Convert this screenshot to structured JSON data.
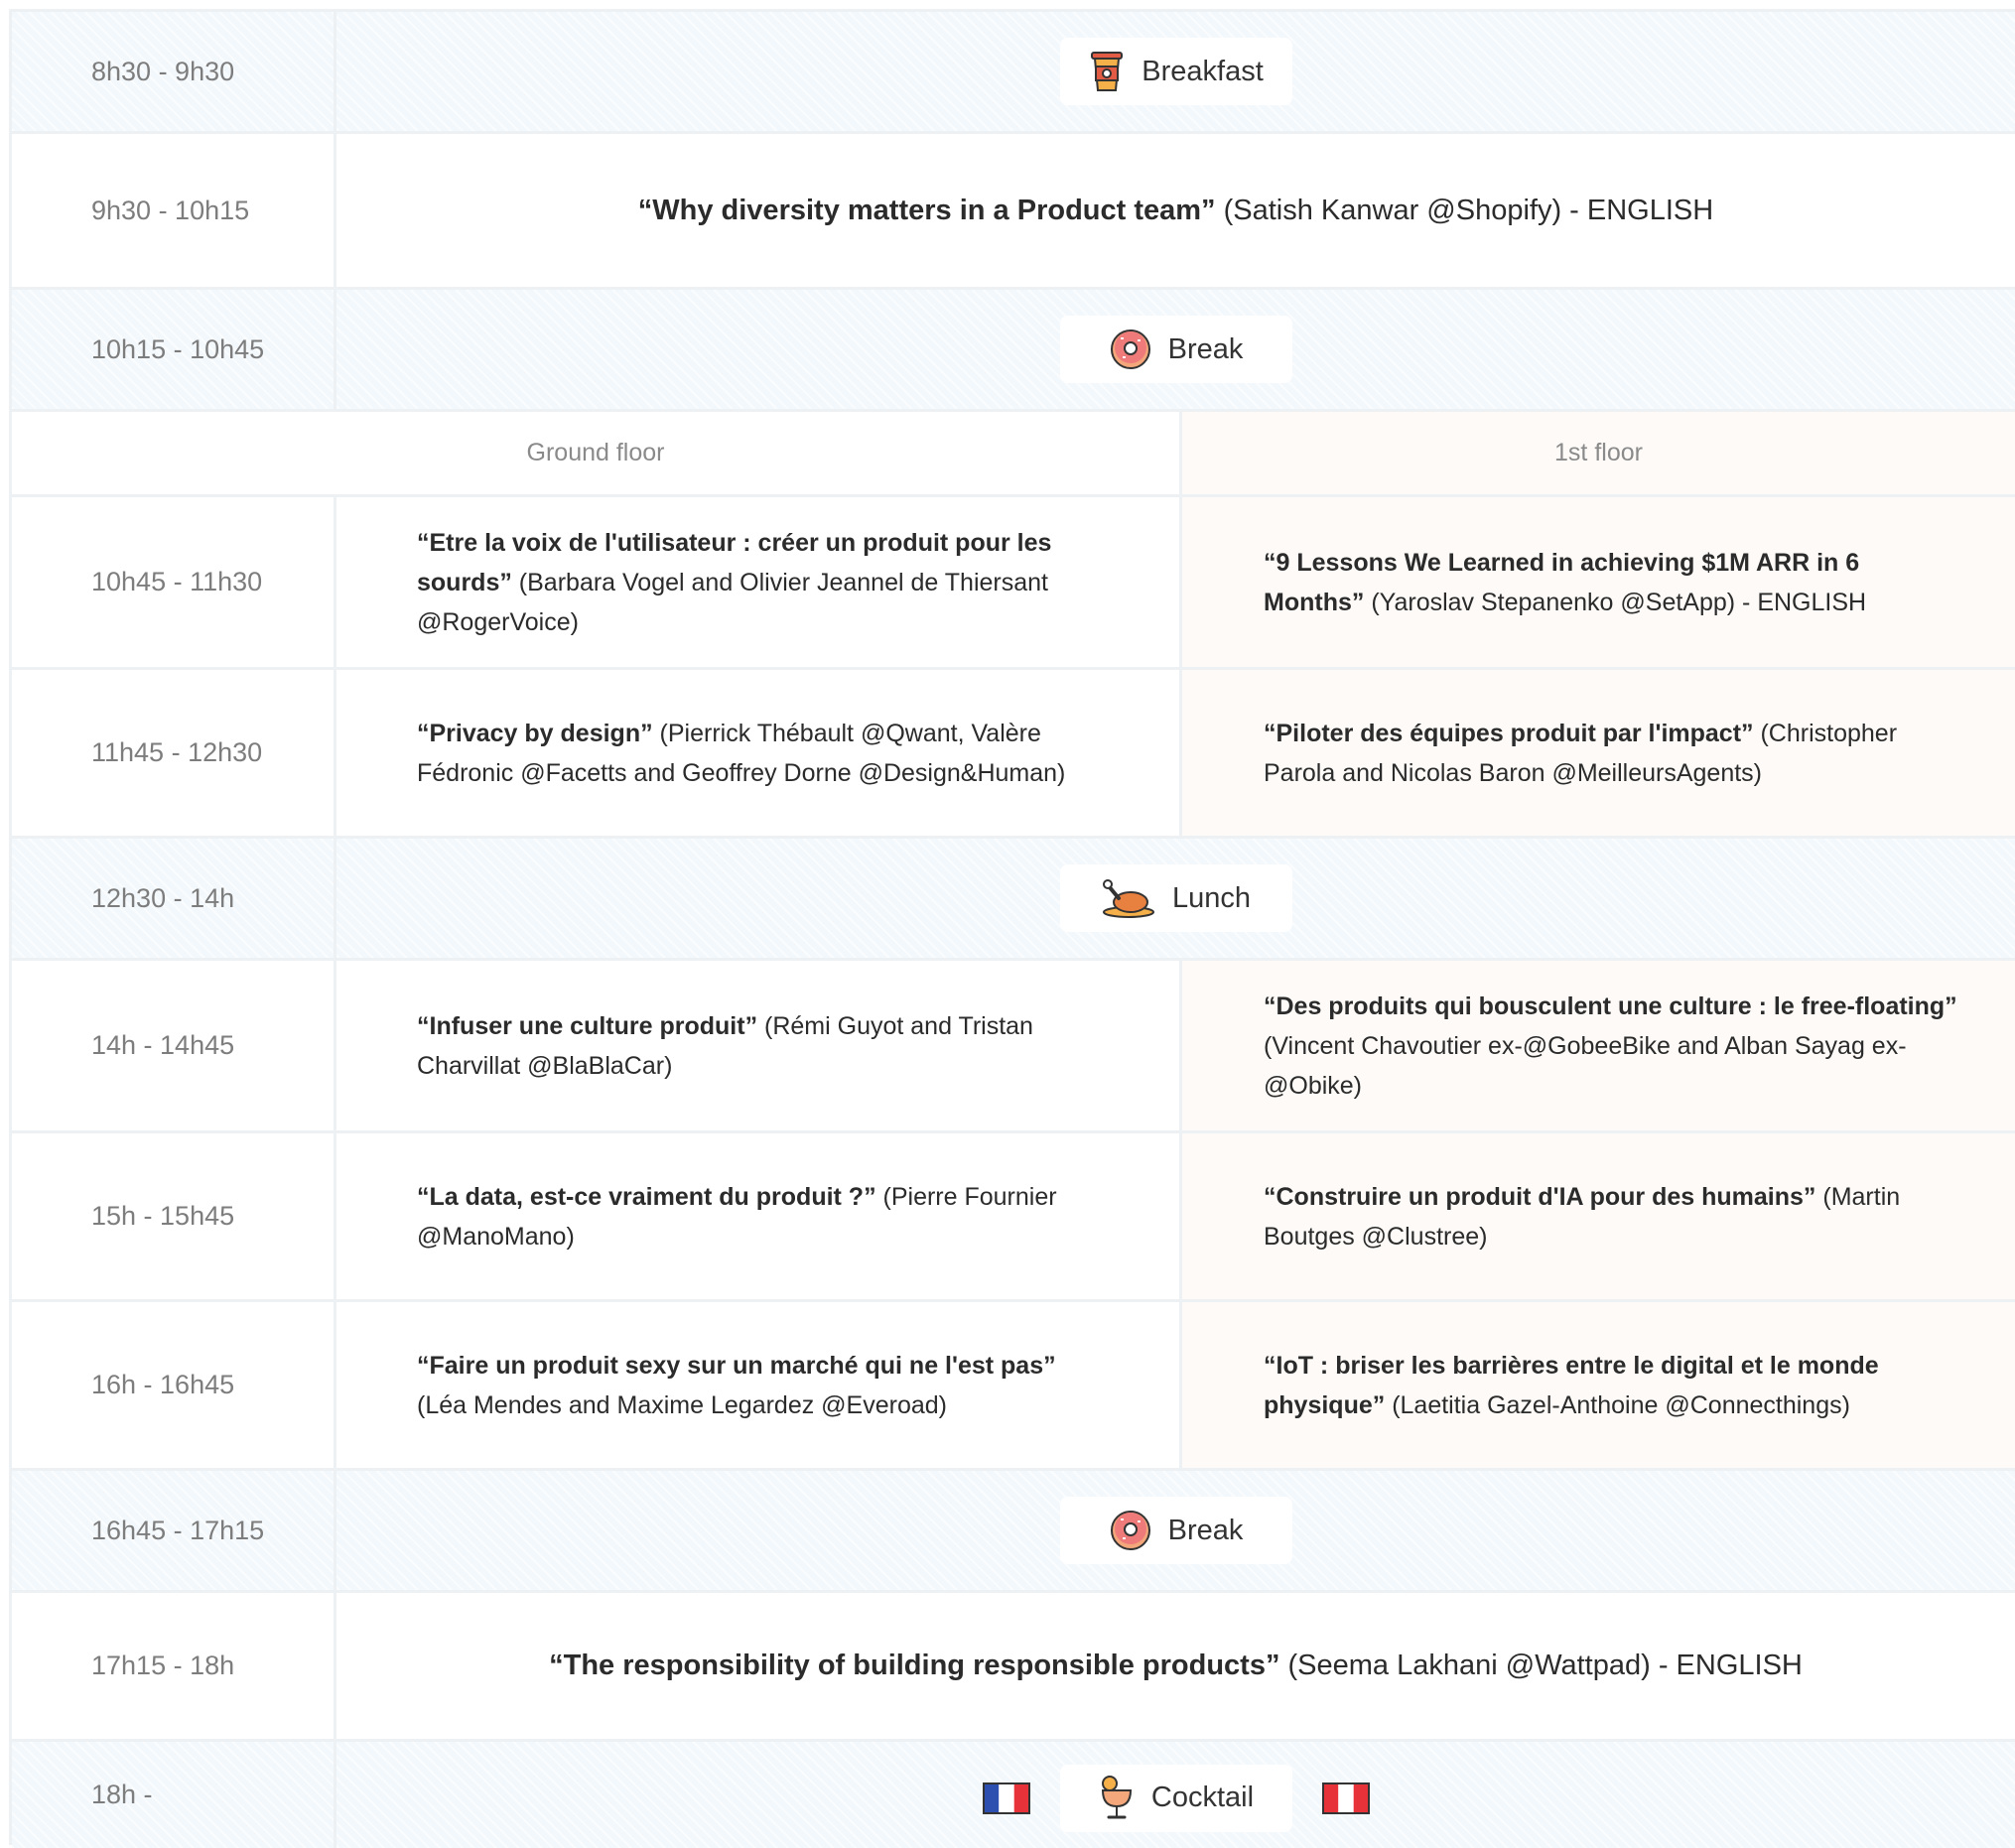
{
  "rooms": {
    "ground": "Ground floor",
    "first": "1st floor"
  },
  "schedule": {
    "breakfast": {
      "time": "8h30 - 9h30",
      "label": "Breakfast"
    },
    "keynote1": {
      "time": "9h30 - 10h15",
      "title": "“Why diversity matters in a Product team”",
      "rest": " (Satish Kanwar @Shopify) - ENGLISH"
    },
    "break1": {
      "time": "10h15 - 10h45",
      "label": "Break"
    },
    "s1": {
      "time": "10h45 - 11h30",
      "ground": {
        "title": "“Etre la voix de l'utilisateur : créer un produit pour les sourds”",
        "rest": " (Barbara Vogel and Olivier Jeannel de Thiersant @RogerVoice)"
      },
      "first": {
        "title": "“9 Lessons We Learned in achieving $1M ARR in 6 Months”",
        "rest": " (Yaroslav Stepanenko @SetApp) - ENGLISH"
      }
    },
    "s2": {
      "time": "11h45 - 12h30",
      "ground": {
        "title": "“Privacy by design”",
        "rest": " (Pierrick Thébault @Qwant, Valère Fédronic @Facetts and Geoffrey Dorne @Design&Human)"
      },
      "first": {
        "title": "“Piloter des équipes produit par l'impact”",
        "rest": " (Christopher Parola and Nicolas Baron @MeilleursAgents)"
      }
    },
    "lunch": {
      "time": "12h30 - 14h",
      "label": "Lunch"
    },
    "s3": {
      "time": "14h - 14h45",
      "ground": {
        "title": "“Infuser une culture produit”",
        "rest": " (Rémi Guyot and Tristan Charvillat @BlaBlaCar)"
      },
      "first": {
        "title": "“Des produits qui bousculent une culture : le free-floating”",
        "rest": " (Vincent Chavoutier ex-@GobeeBike and Alban Sayag ex-@Obike)"
      }
    },
    "s4": {
      "time": "15h - 15h45",
      "ground": {
        "title": "“La data, est-ce vraiment du produit ?”",
        "rest": " (Pierre Fournier @ManoMano)"
      },
      "first": {
        "title": "“Construire un produit d'IA pour des humains”",
        "rest": " (Martin Boutges @Clustree)"
      }
    },
    "s5": {
      "time": "16h - 16h45",
      "ground": {
        "title": "“Faire un produit sexy sur un marché qui ne l'est pas”",
        "rest": " (Léa Mendes and Maxime Legardez @Everoad)"
      },
      "first": {
        "title": "“IoT : briser les barrières entre le digital et le monde physique”",
        "rest": " (Laetitia Gazel-Anthoine @Connecthings)"
      }
    },
    "break2": {
      "time": "16h45 - 17h15",
      "label": "Break"
    },
    "keynote2": {
      "time": "17h15 - 18h",
      "title": "“The responsibility of building responsible products”",
      "rest": " (Seema Lakhani @Wattpad) - ENGLISH"
    },
    "cocktail": {
      "time": "18h -",
      "label": "Cocktail"
    }
  },
  "icons": {
    "breakfast": "coffee-cup-icon",
    "break": "donut-icon",
    "lunch": "roast-chicken-icon",
    "cocktail": "cocktail-glass-icon",
    "flag_left": "france-flag-icon",
    "flag_right": "peru-flag-icon"
  },
  "colors": {
    "break_bg": "#f3f8fc",
    "first_floor_bg": "#fdfaf7",
    "border": "#eef1f4",
    "time_text": "#7d7d7d"
  }
}
